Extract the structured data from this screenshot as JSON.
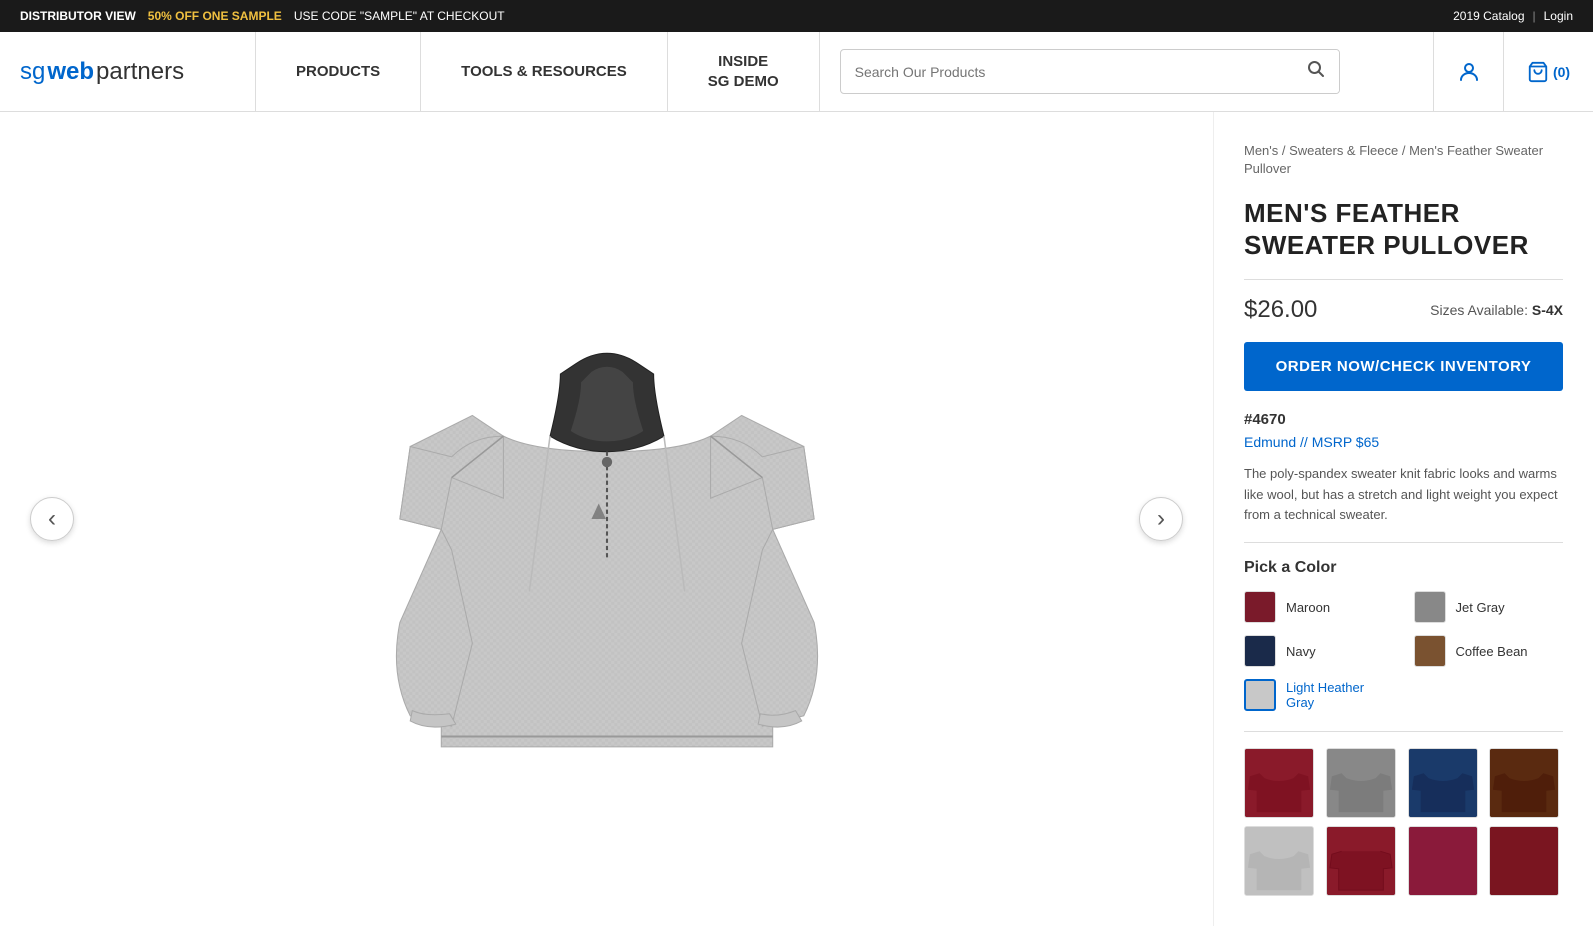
{
  "announcement": {
    "distributor_label": "DISTRIBUTOR VIEW",
    "promo_highlight": "50% OFF ONE SAMPLE",
    "promo_text": "USE CODE \"SAMPLE\" AT CHECKOUT",
    "catalog_label": "2019 Catalog",
    "separator": "|",
    "login_label": "Login"
  },
  "nav": {
    "logo_sg": "sg",
    "logo_web": "web",
    "logo_partners": "partners",
    "products_label": "PRODUCTS",
    "tools_label": "TOOLS & RESOURCES",
    "inside_label": "INSIDE\nSG DEMO",
    "search_placeholder": "Search Our Products"
  },
  "cart": {
    "label": "(0)"
  },
  "breadcrumb": {
    "part1": "Men's",
    "sep1": " / ",
    "part2": "Sweaters & Fleece",
    "sep2": " / ",
    "part3": "Men's Feather Sweater Pullover"
  },
  "product": {
    "title": "MEN'S FEATHER SWEATER PULLOVER",
    "price": "$26.00",
    "sizes_prefix": "Sizes Available: ",
    "sizes_value": "S-4X",
    "order_btn_label": "ORDER NOW/CHECK INVENTORY",
    "number_label": "#4670",
    "brand_label": "Edmund // MSRP $65",
    "description": "The poly-spandex sweater knit fabric looks and warms like wool, but has a stretch and light weight you expect from a technical sweater.",
    "color_section_title": "Pick a Color",
    "colors": [
      {
        "name": "Maroon",
        "hex": "#7a1a2a",
        "selected": false
      },
      {
        "name": "Jet Gray",
        "hex": "#888888",
        "selected": false
      },
      {
        "name": "Navy",
        "hex": "#1a2a4a",
        "selected": false
      },
      {
        "name": "Coffee Bean",
        "hex": "#7a5230",
        "selected": false
      },
      {
        "name": "Light Heather Gray",
        "hex": "#c8c8c8",
        "selected": true
      }
    ],
    "thumbnails": [
      {
        "color": "#8a1a2a",
        "label": "Maroon front"
      },
      {
        "color": "#888888",
        "label": "Jet Gray front"
      },
      {
        "color": "#1a3a6a",
        "label": "Navy front"
      },
      {
        "color": "#5a2a10",
        "label": "Coffee Bean front"
      },
      {
        "color": "#c0c0c0",
        "label": "Light Heather Gray front"
      },
      {
        "color": "#8a1a2a",
        "label": "Maroon back"
      },
      {
        "color": "#8a1a3a",
        "label": "Maroon side"
      },
      {
        "color": "#7a1520",
        "label": "Maroon detail"
      }
    ]
  },
  "arrows": {
    "left": "‹",
    "right": "›"
  }
}
